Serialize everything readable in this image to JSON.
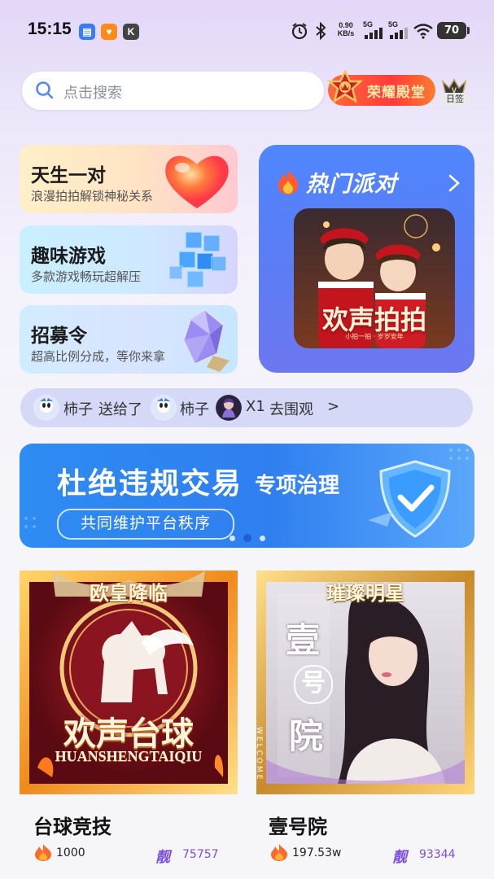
{
  "status_bar": {
    "time": "15:15",
    "app_icons": [
      "message-app-icon",
      "heart-app-icon",
      "k-app-icon"
    ],
    "net_speed": "0.90",
    "net_unit": "KB/s",
    "signal1": "5G",
    "signal2": "5G",
    "battery": "70"
  },
  "search": {
    "placeholder": "点击搜索"
  },
  "top_badges": {
    "honor_hall": "荣耀殿堂",
    "daily_sign": "日签"
  },
  "cards": [
    {
      "title": "天生一对",
      "subtitle": "浪漫拍拍解锁神秘关系",
      "icon": "heart-icon"
    },
    {
      "title": "趣味游戏",
      "subtitle": "多款游戏畅玩超解压",
      "icon": "cube-icon"
    },
    {
      "title": "招募令",
      "subtitle": "超高比例分成，等你来拿",
      "icon": "crystal-icon"
    }
  ],
  "hot_party": {
    "title": "热门派对",
    "image_caption": "欢声拍拍",
    "image_tagline": "小拍一拍 · 岁岁安年"
  },
  "gift_ticker": {
    "sender": "柿子",
    "action": "送给了",
    "receiver": "柿子",
    "count": "X1",
    "link": "去围观",
    "arrow": ">"
  },
  "banner": {
    "title": "杜绝违规交易",
    "title_suffix": "专项治理",
    "pill": "共同维护平台秩序",
    "active_index": 1,
    "page_count": 3
  },
  "rooms": [
    {
      "name": "台球竞技",
      "poster_top": "欧皇降临",
      "poster_title": "欢声台球",
      "poster_sub": "HUANSHENGTAIQIU",
      "heat": "1000",
      "liang_label": "靓",
      "liang_id": "75757"
    },
    {
      "name": "壹号院",
      "poster_top": "璀璨明星",
      "poster_chars": [
        "壹",
        "号",
        "院"
      ],
      "poster_sub": "WELCOME",
      "heat": "197.53w",
      "liang_label": "靓",
      "liang_id": "93344"
    }
  ],
  "colors": {
    "accent_purple": "#7b4fe0",
    "party_blue": "#5b7df5",
    "banner_blue": "#2f7ff0"
  }
}
